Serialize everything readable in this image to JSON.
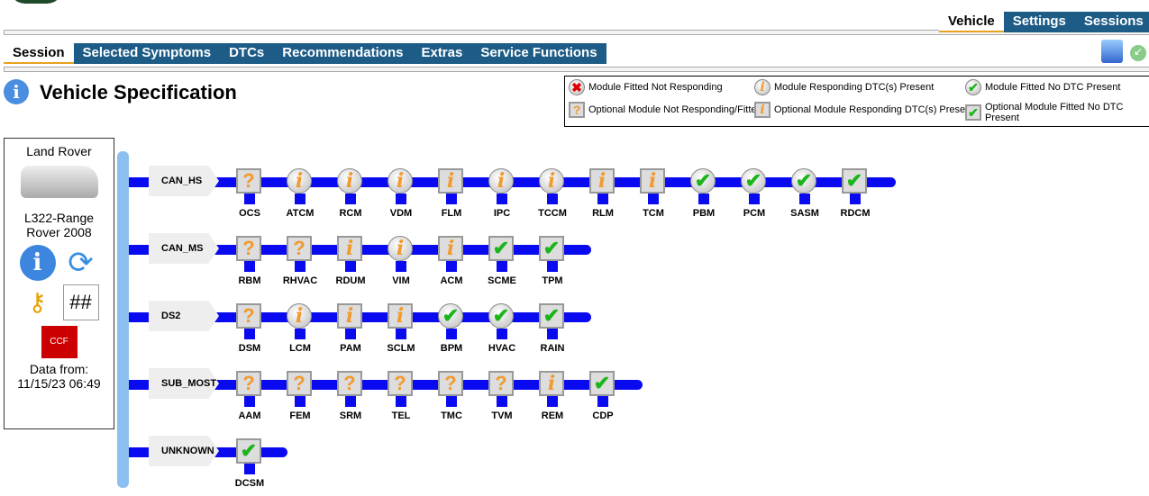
{
  "top_tabs": [
    {
      "label": "Vehicle",
      "active": true
    },
    {
      "label": "Settings"
    },
    {
      "label": "Sessions"
    }
  ],
  "main_tabs": [
    {
      "label": "Session",
      "active": true
    },
    {
      "label": "Selected Symptoms"
    },
    {
      "label": "DTCs"
    },
    {
      "label": "Recommendations"
    },
    {
      "label": "Extras"
    },
    {
      "label": "Service Functions"
    }
  ],
  "page_title": "Vehicle Specification",
  "legend": [
    {
      "icon": "x",
      "shape": "rd",
      "label": "Module Fitted Not Responding"
    },
    {
      "icon": "i",
      "shape": "rd",
      "label": "Module Responding DTC(s) Present"
    },
    {
      "icon": "ok",
      "shape": "rd",
      "label": "Module Fitted No DTC Present"
    },
    {
      "icon": "q",
      "shape": "sq",
      "label": "Optional Module Not Responding/Fitted"
    },
    {
      "icon": "i",
      "shape": "sq",
      "label": "Optional Module Responding DTC(s) Present"
    },
    {
      "icon": "ok",
      "shape": "sq",
      "label": "Optional Module Fitted No DTC Present"
    }
  ],
  "vehicle": {
    "brand": "Land Rover",
    "model": "L322-Range Rover 2008",
    "data_from_label": "Data from:",
    "data_from": "11/15/23 06:49"
  },
  "buses": [
    {
      "name": "CAN_HS",
      "modules": [
        [
          "OCS",
          "sq",
          "q"
        ],
        [
          "ATCM",
          "rd",
          "i"
        ],
        [
          "RCM",
          "rd",
          "i"
        ],
        [
          "VDM",
          "rd",
          "i"
        ],
        [
          "FLM",
          "sq",
          "i"
        ],
        [
          "IPC",
          "rd",
          "i"
        ],
        [
          "TCCM",
          "rd",
          "i"
        ],
        [
          "RLM",
          "sq",
          "i"
        ],
        [
          "TCM",
          "sq",
          "i"
        ],
        [
          "PBM",
          "rd",
          "ok"
        ],
        [
          "PCM",
          "rd",
          "ok"
        ],
        [
          "SASM",
          "rd",
          "ok"
        ],
        [
          "RDCM",
          "sq",
          "ok"
        ]
      ]
    },
    {
      "name": "CAN_MS",
      "modules": [
        [
          "RBM",
          "sq",
          "q"
        ],
        [
          "RHVAC",
          "sq",
          "q"
        ],
        [
          "RDUM",
          "sq",
          "i"
        ],
        [
          "VIM",
          "rd",
          "i"
        ],
        [
          "ACM",
          "sq",
          "i"
        ],
        [
          "SCME",
          "sq",
          "ok"
        ],
        [
          "TPM",
          "sq",
          "ok"
        ]
      ]
    },
    {
      "name": "DS2",
      "modules": [
        [
          "DSM",
          "sq",
          "q"
        ],
        [
          "LCM",
          "rd",
          "i"
        ],
        [
          "PAM",
          "sq",
          "i"
        ],
        [
          "SCLM",
          "sq",
          "i"
        ],
        [
          "BPM",
          "rd",
          "ok"
        ],
        [
          "HVAC",
          "rd",
          "ok"
        ],
        [
          "RAIN",
          "sq",
          "ok"
        ]
      ]
    },
    {
      "name": "SUB_MOST",
      "modules": [
        [
          "AAM",
          "sq",
          "q"
        ],
        [
          "FEM",
          "sq",
          "q"
        ],
        [
          "SRM",
          "sq",
          "q"
        ],
        [
          "TEL",
          "sq",
          "q"
        ],
        [
          "TMC",
          "sq",
          "q"
        ],
        [
          "TVM",
          "sq",
          "q"
        ],
        [
          "REM",
          "sq",
          "i"
        ],
        [
          "CDP",
          "sq",
          "ok"
        ]
      ]
    },
    {
      "name": "UNKNOWN",
      "modules": [
        [
          "DCSM",
          "sq",
          "ok"
        ]
      ]
    }
  ]
}
